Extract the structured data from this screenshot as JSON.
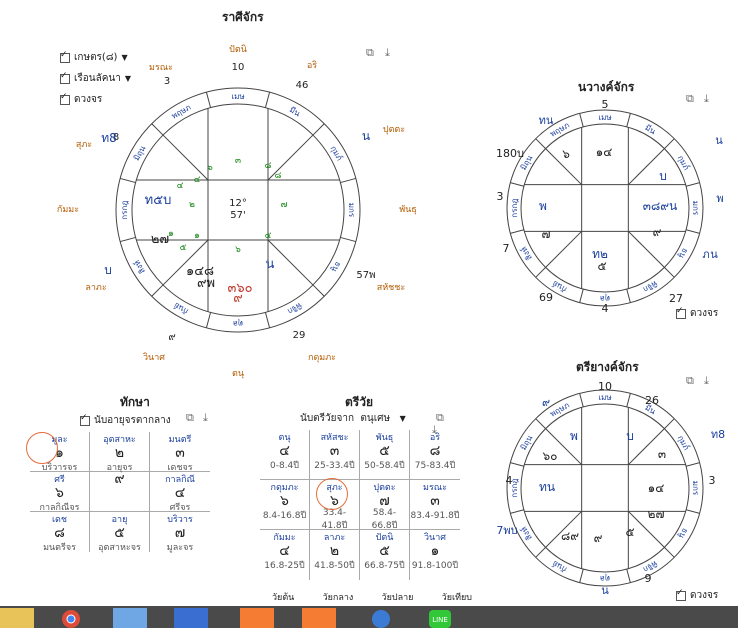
{
  "rasi": {
    "title": "ราศีจักร",
    "checkboxes": [
      "เกษตร(๘)",
      "เรือนลัคนา",
      "ดวงจร"
    ],
    "signs": [
      "เมษ",
      "มีน",
      "กุมภ์",
      "มกร",
      "ธนู",
      "พิจิก",
      "ตุล",
      "กันย์",
      "สิงห์",
      "กรกฎ",
      "มิถุน",
      "พฤษภ"
    ],
    "center": [
      "12°",
      "57'"
    ],
    "outer_orange": [
      "ปัตนิ",
      "อริ",
      "ปุตตะ",
      "พันธุ",
      "สหัชชะ",
      "กดุมภะ",
      "ตนุ",
      "วินาศ",
      "ลาภะ",
      "กัมมะ",
      "สุภะ",
      "มรณะ"
    ],
    "outer_nums": [
      "10",
      "46",
      "3",
      "29",
      "8",
      "57พ",
      "๙"
    ],
    "outer_blue": [
      "น",
      "ท8",
      "บ"
    ],
    "houses": [
      "๓",
      "๘",
      "๗",
      "๕",
      "๖",
      "๑",
      "๒",
      "๔",
      "๖",
      "๔",
      "๑",
      "๕",
      "๘"
    ],
    "planets": [
      "ท๕บ",
      "๒๗",
      "๑๔๘",
      "๙พ",
      "น",
      "๓๖๐",
      "๙"
    ]
  },
  "navamsa": {
    "title": "นวางค์จักร",
    "signs": [
      "เมษ",
      "มีน",
      "กุมภ์",
      "มกร",
      "ธนู",
      "พิจิก",
      "ตุล",
      "กันย์",
      "สิงห์",
      "กรกฎ",
      "มิถุน",
      "พฤษภ"
    ],
    "outer": [
      "5",
      "ทน",
      "180บ",
      "น",
      "3",
      "พ",
      "7",
      "69",
      "4",
      "27",
      "ภ",
      "น"
    ],
    "planets": [
      "๖",
      "๑๔",
      "บ",
      "พ",
      "๓๘๙น",
      "๗",
      "๙",
      "ท๒",
      "๕"
    ],
    "checkbox": "ดวงจร"
  },
  "trivamsa": {
    "title": "ตรียางค์จักร",
    "signs": [
      "เมษ",
      "มีน",
      "กุมภ์",
      "มกร",
      "ธนู",
      "พิจิก",
      "ตุล",
      "กันย์",
      "สิงห์",
      "กรกฎ",
      "มิถุน",
      "พฤษภ"
    ],
    "outer": [
      "10",
      "26",
      "๙",
      "ท8",
      "4",
      "3",
      "7พบ",
      "9",
      "น"
    ],
    "planets": [
      "พ",
      "บ",
      "๓",
      "๖๐",
      "ทน",
      "๑๔",
      "๒๗",
      "๘๙",
      "๙",
      "๕"
    ],
    "checkbox": "ดวงจร"
  },
  "taksa": {
    "title": "ทักษา",
    "checkbox": "นับอายุจรตากลาง",
    "cells": [
      {
        "label": "มูละ",
        "num": "๑",
        "sub": "บริวารจร"
      },
      {
        "label": "อุตสาหะ",
        "num": "๒",
        "sub": "อายุจร"
      },
      {
        "label": "มนตรี",
        "num": "๓",
        "sub": "เดชจร"
      },
      {
        "label": "ศรี",
        "num": "๖",
        "sub": "กาลกิณีจร"
      },
      {
        "label": "",
        "num": "๙",
        "sub": ""
      },
      {
        "label": "กาลกิณี",
        "num": "๔",
        "sub": "ศรีจร"
      },
      {
        "label": "เดช",
        "num": "๘",
        "sub": "มนตรีจร"
      },
      {
        "label": "อายุ",
        "num": "๕",
        "sub": "อุตสาหะจร"
      },
      {
        "label": "บริวาร",
        "num": "๗",
        "sub": "มูละจร"
      }
    ]
  },
  "triwai": {
    "title": "ตรีวัย",
    "dropdown_label": "นับตรีวัยจาก",
    "dropdown_value": "ตนุเศษ",
    "cells": [
      {
        "label": "ตนุ",
        "num": "๔",
        "sub": "0-8.4ปี"
      },
      {
        "label": "สหัสชะ",
        "num": "๓",
        "sub": "25-33.4ปี"
      },
      {
        "label": "พันธุ",
        "num": "๕",
        "sub": "50-58.4ปี"
      },
      {
        "label": "อริ",
        "num": "๘",
        "sub": "75-83.4ปี"
      },
      {
        "label": "กดุมภะ",
        "num": "๖",
        "sub": "8.4-16.8ปี"
      },
      {
        "label": "สุภะ",
        "num": "๖",
        "sub": "33.4-41.8ปี"
      },
      {
        "label": "ปุตตะ",
        "num": "๗",
        "sub": "58.4-66.8ปี"
      },
      {
        "label": "มรณะ",
        "num": "๓",
        "sub": "83.4-91.8ปี"
      },
      {
        "label": "กัมมะ",
        "num": "๔",
        "sub": "16.8-25ปี"
      },
      {
        "label": "ลาภะ",
        "num": "๒",
        "sub": "41.8-50ปี"
      },
      {
        "label": "ปัตนิ",
        "num": "๕",
        "sub": "66.8-75ปี"
      },
      {
        "label": "วินาศ",
        "num": "๑",
        "sub": "91.8-100ปี"
      }
    ],
    "footer": [
      "วัยต้น",
      "วัยกลาง",
      "วัยปลาย",
      "วัยเทียบ"
    ]
  },
  "taskbar": {
    "apps": [
      "folder",
      "chrome",
      "calculator",
      "notepad",
      "snip",
      "camera",
      "browser",
      "line"
    ]
  }
}
